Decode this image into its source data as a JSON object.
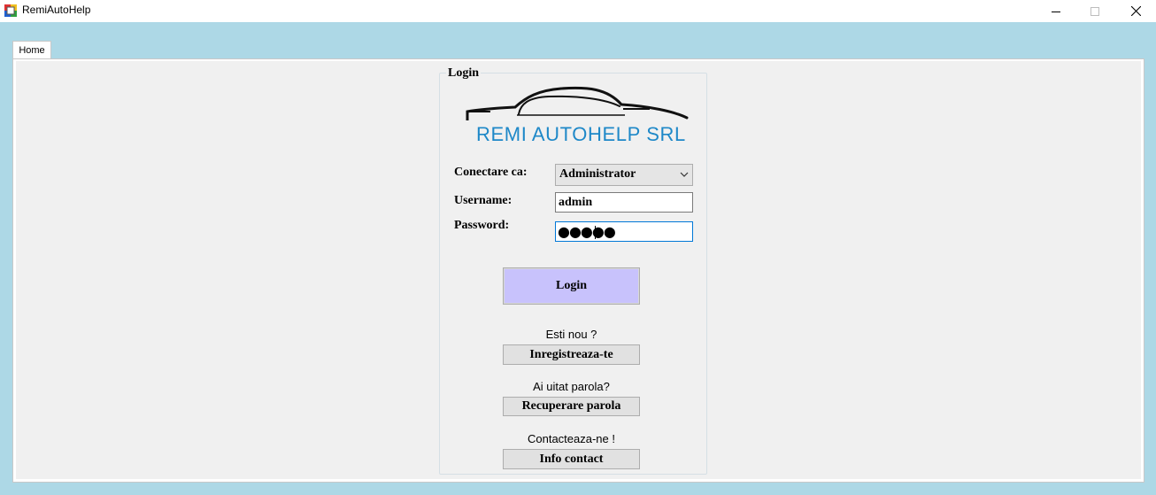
{
  "window": {
    "title": "RemiAutoHelp",
    "app_icon": "app-icon",
    "minimize_icon": "minimize-icon",
    "maximize_icon": "maximize-icon",
    "close_icon": "close-icon"
  },
  "tabs": [
    {
      "label": "Home"
    }
  ],
  "login_group": {
    "title": "Login",
    "logo_icon": "car-silhouette-icon",
    "brand": "REMI AUTOHELP SRL",
    "brand_color": "#1e88c8"
  },
  "form": {
    "connect_as_label": "Conectare ca:",
    "connect_as_value": "Administrator",
    "username_label": "Username:",
    "username_value": "admin",
    "password_label": "Password:",
    "password_masked": "●●●●●"
  },
  "buttons": {
    "login": "Login",
    "login_color": "#c8c2fc",
    "register": "Inregistreaza-te",
    "recover": "Recuperare parola",
    "contact": "Info contact"
  },
  "prompts": {
    "new_user": "Esti nou ?",
    "forgot_password": "Ai uitat parola?",
    "contact_us": "Contacteaza-ne !"
  },
  "colors": {
    "background": "#add8e6",
    "panel": "#f0f0f0"
  }
}
